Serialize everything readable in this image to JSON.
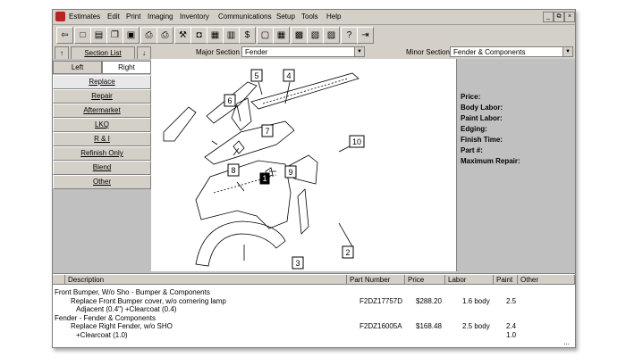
{
  "menu": [
    "Estimates",
    "Edit",
    "Print",
    "Imaging",
    "Inventory",
    "Communications",
    "Setup",
    "Tools",
    "Help"
  ],
  "window_controls": [
    "_",
    "⧉",
    "×"
  ],
  "toolbar_icons": [
    "back-arrow-icon",
    "new-document-icon",
    "open-document-icon",
    "copy-icon",
    "save-icon",
    "print-icon",
    "print-preview-icon",
    "tools-icon",
    "camera-icon",
    "folder-icon",
    "inventory-icon",
    "dollar-icon",
    "display-icon",
    "grid-icon",
    "image-icon",
    "parts-icon",
    "photo-icon",
    "help-icon",
    "exit-icon"
  ],
  "toolbar_glyphs": [
    "⇦",
    "□",
    "▤",
    "❐",
    "▣",
    "⎙",
    "⎙",
    "⚒",
    "◘",
    "▦",
    "▥",
    "$",
    "▢",
    "▦",
    "▩",
    "▧",
    "▨",
    "?",
    "⇥"
  ],
  "nav": {
    "up_arrow": "↑",
    "down_arrow": "↓",
    "section_list": "Section List",
    "major_label": "Major Section",
    "major_value": "Fender",
    "minor_label": "Minor Section",
    "minor_value": "Fender & Components"
  },
  "side_tabs": [
    "Left",
    "Right"
  ],
  "operations": [
    "Replace",
    "Repair",
    "Aftermarket",
    "LKQ",
    "R & I",
    "Refinish Only",
    "Blend",
    "Other"
  ],
  "diagram_callouts": [
    "1",
    "2",
    "3",
    "4",
    "5",
    "6",
    "7",
    "8",
    "9",
    "10"
  ],
  "info_labels": [
    "Price:",
    "Body Labor:",
    "Paint Labor:",
    "Edging:",
    "Finish Time:",
    "Part #:",
    "Maximum Repair:"
  ],
  "grid": {
    "headers": [
      "Description",
      "Part Number",
      "Price",
      "Labor",
      "Paint",
      "Other"
    ],
    "rows": [
      {
        "desc": "Front Bumper, W/o Sho - Bumper & Components",
        "part": "",
        "price": "",
        "labor": "",
        "paint": ""
      },
      {
        "desc": "Replace Front Bumper cover, w/o cornering lamp",
        "part": "F2DZ17757D",
        "price": "$288.20",
        "labor": "1.6 body",
        "paint": "2.5"
      },
      {
        "desc": "Adjacent (0.4\") +Clearcoat (0.4)",
        "part": "",
        "price": "",
        "labor": "",
        "paint": ""
      },
      {
        "desc": "Fender - Fender & Components",
        "part": "",
        "price": "",
        "labor": "",
        "paint": ""
      },
      {
        "desc": "Replace Right Fender, w/o SHO",
        "part": "F2DZ16005A",
        "price": "$168.48",
        "labor": "2.5 body",
        "paint": "2.4"
      },
      {
        "desc": "+Clearcoat (1.0)",
        "part": "",
        "price": "",
        "labor": "",
        "paint": "1.0"
      }
    ],
    "ellipsis": "..."
  }
}
